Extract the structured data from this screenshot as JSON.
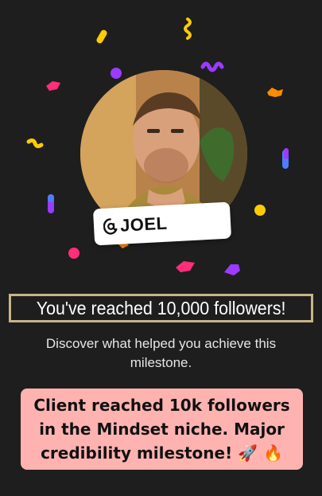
{
  "profile": {
    "handle": "JOEL",
    "handle_icon": "threads-at-icon"
  },
  "milestone": {
    "headline": "You've reached 10,000 followers!",
    "subtext": "Discover what helped you achieve this milestone."
  },
  "caption": {
    "text": "Client reached 10k followers in the Mindset niche. Major credibility milestone! 🚀 🔥"
  },
  "colors": {
    "background": "#1e1e1e",
    "headline_border": "#c8b48a",
    "caption_background": "#ffb3b0",
    "confetti": [
      "#ffcc00",
      "#9b3bff",
      "#ff2d7a",
      "#ff8a00",
      "#4c7dff",
      "#ff3b3b"
    ]
  }
}
